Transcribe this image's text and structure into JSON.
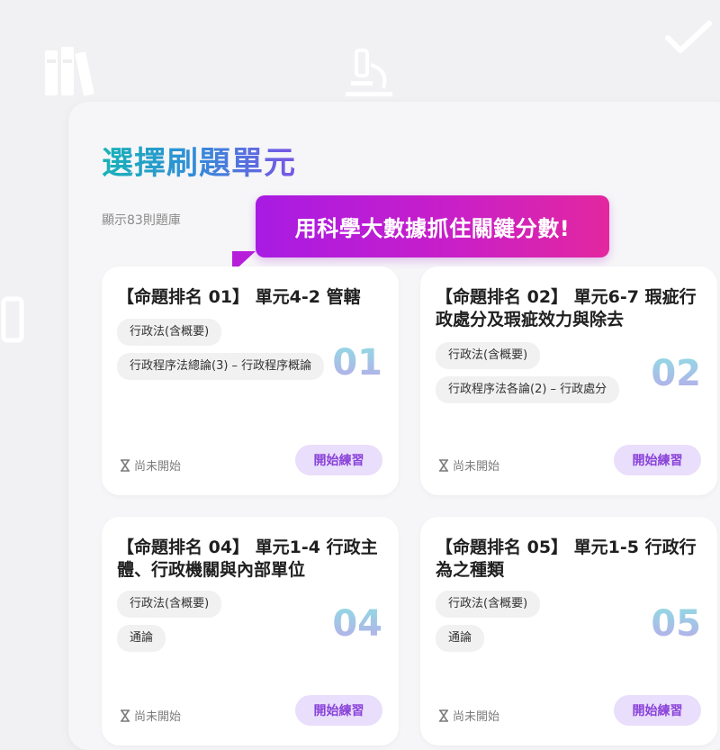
{
  "header": {
    "title": "選擇刷題單元",
    "subtitle": "顯示83則題庫"
  },
  "promo_banner": {
    "text": "用科學大數據抓住關鍵分數!"
  },
  "cards": [
    {
      "title": "【命題排名 01】 單元4-2 管轄",
      "number": "01",
      "tags": [
        "行政法(含概要)",
        "行政程序法總論(3) – 行政程序概論"
      ],
      "status": "尚未開始",
      "button": "開始練習"
    },
    {
      "title": "【命題排名 02】 單元6-7 瑕疵行政處分及瑕疵效力與除去",
      "number": "02",
      "tags": [
        "行政法(含概要)",
        "行政程序法各論(2) – 行政處分"
      ],
      "status": "尚未開始",
      "button": "開始練習"
    },
    {
      "title": "【命題排名 04】 單元1-4 行政主體、行政機關與內部單位",
      "number": "04",
      "tags": [
        "行政法(含概要)",
        "通論"
      ],
      "status": "尚未開始",
      "button": "開始練習"
    },
    {
      "title": "【命題排名 05】 單元1-5 行政行為之種類",
      "number": "05",
      "tags": [
        "行政法(含概要)",
        "通論"
      ],
      "status": "尚未開始",
      "button": "開始練習"
    }
  ],
  "background_icons": [
    "books-icon",
    "microscope-icon",
    "checkmark-icon",
    "pencil-icon"
  ],
  "colors": {
    "accent_purple": "#8a43d9",
    "button_bg": "#e9defb",
    "banner_start": "#a81be3",
    "banner_end": "#e3279f",
    "title_teal": "#18b3b7",
    "title_violet": "#7a55e6"
  }
}
